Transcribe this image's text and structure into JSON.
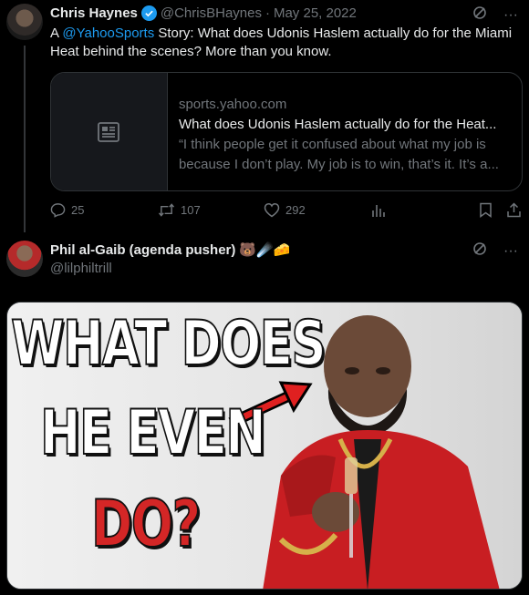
{
  "tweet1": {
    "author_name": "Chris Haynes",
    "handle": "@ChrisBHaynes",
    "separator": "·",
    "date": "May 25, 2022",
    "text_prefix": "A ",
    "mention": "@YahooSports",
    "text_suffix": " Story: What does Udonis Haslem actually do for the Miami Heat behind the scenes? More than you know.",
    "card": {
      "domain": "sports.yahoo.com",
      "title": "What does Udonis Haslem actually do for the Heat...",
      "description": "“I think people get it confused about what my job is because I don’t play. My job is to win, that’s it. It’s a..."
    },
    "counts": {
      "replies": "25",
      "retweets": "107",
      "likes": "292"
    }
  },
  "tweet2": {
    "author_name": "Phil al-Gaib (agenda pusher)",
    "emojis": "🐻☄️🧀",
    "handle": "@lilphiltrill",
    "image": {
      "line1": "WHAT DOES",
      "line2": "HE EVEN",
      "line3": "DO?"
    }
  },
  "colors": {
    "accent": "#1d9bf0",
    "muted": "#71767b",
    "text": "#e7e9ea",
    "meme_red": "#d42626"
  }
}
